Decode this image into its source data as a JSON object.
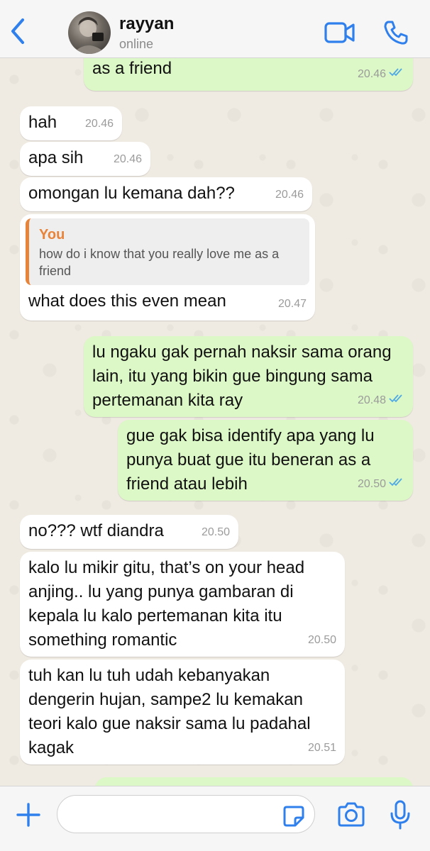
{
  "header": {
    "back_icon": "chevron-left-icon",
    "contact_name": "rayyan",
    "contact_status": "online",
    "video_icon": "video-camera-icon",
    "call_icon": "phone-icon"
  },
  "messages": [
    {
      "direction": "out",
      "text": "as a friend",
      "time": "20.46",
      "read": true
    },
    {
      "direction": "in",
      "text": "hah",
      "time": "20.46"
    },
    {
      "direction": "in",
      "text": "apa sih",
      "time": "20.46"
    },
    {
      "direction": "in",
      "text": "omongan lu kemana dah??",
      "time": "20.46"
    },
    {
      "direction": "in",
      "reply_to": {
        "author": "You",
        "text": "how do i know that you really love me as a friend"
      },
      "text": "what does this even mean",
      "time": "20.47"
    },
    {
      "direction": "out",
      "text": "lu ngaku gak pernah naksir sama orang lain, itu yang bikin gue bingung sama pertemanan kita ray",
      "time": "20.48",
      "read": true
    },
    {
      "direction": "out",
      "text": "gue gak bisa identify apa yang lu punya buat gue itu beneran as a friend atau lebih",
      "time": "20.50",
      "read": true
    },
    {
      "direction": "in",
      "text": "no??? wtf diandra",
      "time": "20.50"
    },
    {
      "direction": "in",
      "text": "kalo lu mikir gitu, that’s on your head anjing.. lu yang punya gambaran di kepala lu kalo pertemanan kita itu something romantic",
      "time": "20.50"
    },
    {
      "direction": "in",
      "text": "tuh kan lu tuh udah kebanyakan dengerin hujan, sampe2 lu kemakan teori kalo gue naksir sama lu padahal kagak",
      "time": "20.51"
    }
  ],
  "footer": {
    "plus_icon": "plus-icon",
    "input_value": "",
    "sticker_icon": "sticker-icon",
    "camera_icon": "camera-icon",
    "mic_icon": "microphone-icon"
  },
  "colors": {
    "accent": "#2f80ed",
    "incoming_bubble": "#ffffff",
    "outgoing_bubble": "#dcf8c6",
    "read_ticks": "#4fa9e6",
    "quote_author": "#e8833a",
    "chat_background": "#efeae2"
  }
}
